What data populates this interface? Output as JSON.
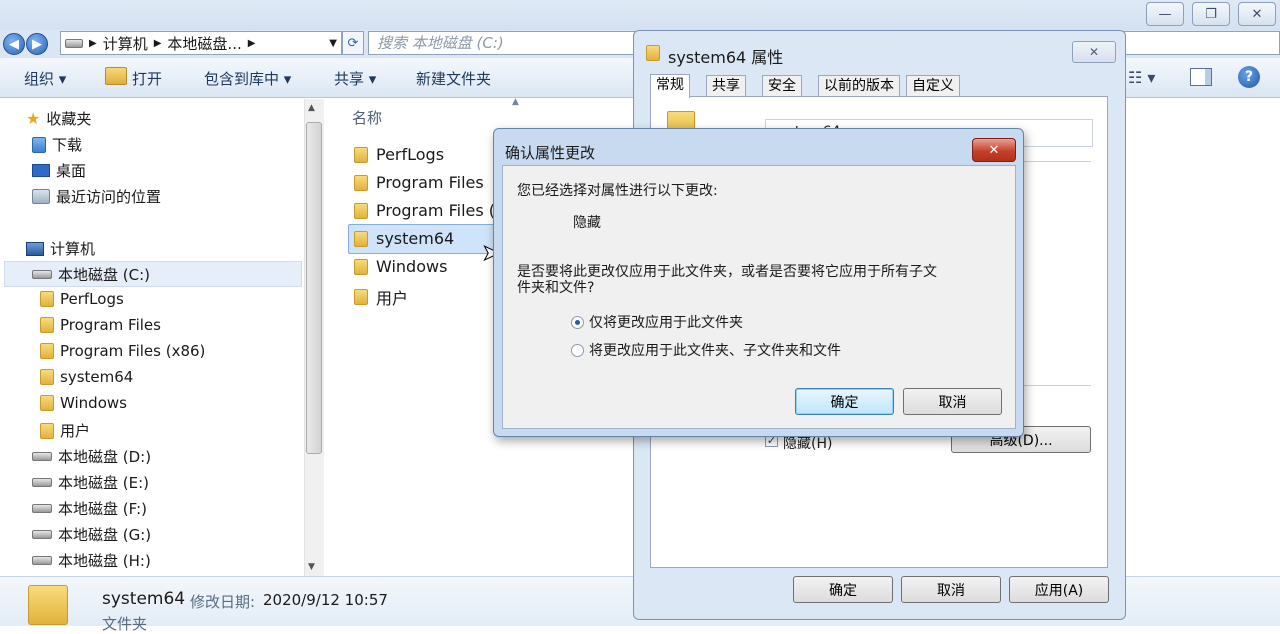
{
  "explorer": {
    "nav_back": "◀",
    "nav_forward": "▶",
    "breadcrumb": [
      "计算机",
      "本地磁盘..."
    ],
    "search_placeholder": "搜索 本地磁盘 (C:)",
    "toolbar": {
      "organize": "组织 ▾",
      "open": "打开",
      "include_library": "包含到库中 ▾",
      "share": "共享 ▾",
      "new_folder": "新建文件夹"
    },
    "nav_pane": {
      "favorites": "收藏夹",
      "fav_items": [
        "下载",
        "桌面",
        "最近访问的位置"
      ],
      "computer": "计算机",
      "drive_c": "本地磁盘 (C:)",
      "c_children": [
        "PerfLogs",
        "Program Files",
        "Program Files (x86)",
        "system64",
        "Windows",
        "用户"
      ],
      "drives": [
        "本地磁盘 (D:)",
        "本地磁盘 (E:)",
        "本地磁盘 (F:)",
        "本地磁盘 (G:)",
        "本地磁盘 (H:)"
      ]
    },
    "file_pane": {
      "column_name": "名称",
      "items": [
        "PerfLogs",
        "Program Files",
        "Program Files (",
        "system64",
        "Windows",
        "用户"
      ],
      "selected": "system64"
    },
    "details": {
      "name": "system64",
      "modified_label": "修改日期:",
      "modified": "2020/9/12 10:57",
      "type": "文件夹"
    }
  },
  "properties_dialog": {
    "title": "system64 属性",
    "close": "✕",
    "tabs": [
      "常规",
      "共享",
      "安全",
      "以前的版本",
      "自定义"
    ],
    "folder_name_partial": "system64",
    "hidden_label": "隐藏(H)",
    "advanced_button": "高级(D)...",
    "ok": "确定",
    "cancel": "取消",
    "apply": "应用(A)"
  },
  "confirm_dialog": {
    "title": "确认属性更改",
    "close": "✕",
    "intro": "您已经选择对属性进行以下更改:",
    "change": "隐藏",
    "question_line1": "是否要将此更改仅应用于此文件夹，或者是否要将它应用于所有子文",
    "question_line2": "件夹和文件?",
    "option_1": "仅将更改应用于此文件夹",
    "option_2": "将更改应用于此文件夹、子文件夹和文件",
    "selected_option": 1,
    "ok": "确定",
    "cancel": "取消"
  }
}
